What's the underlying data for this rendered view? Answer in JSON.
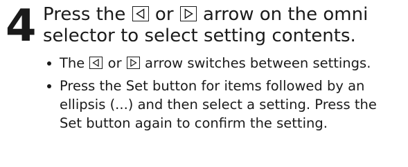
{
  "step": {
    "number": "4",
    "heading": {
      "part1": "Press the ",
      "left_icon": "left-arrow-key-icon",
      "part2": " or ",
      "right_icon": "right-arrow-key-icon",
      "part3": " arrow on the omni selector to select setting contents."
    },
    "bullets": [
      {
        "part1": "The ",
        "left_icon": "left-arrow-key-icon",
        "part2": " or ",
        "right_icon": "right-arrow-key-icon",
        "part3": " arrow switches between settings."
      },
      {
        "text": "Press the Set button for items followed by an ellipsis (...) and then select a setting. Press the Set button again to confirm the setting."
      }
    ]
  }
}
